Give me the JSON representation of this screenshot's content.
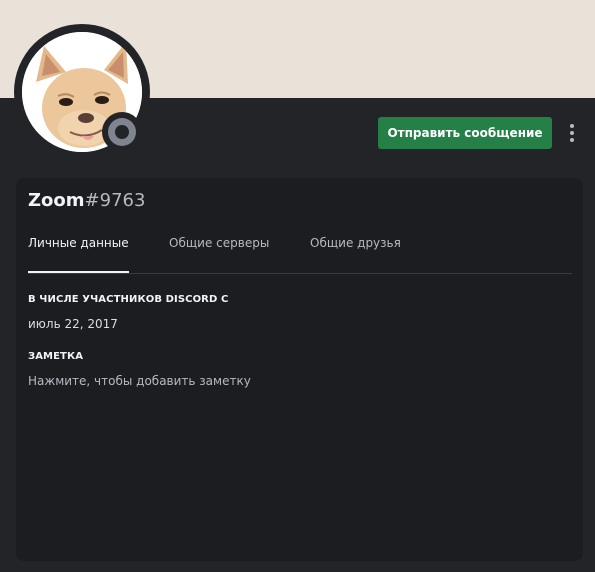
{
  "profile": {
    "username": "Zoom",
    "discriminator": "#9763",
    "status": "offline",
    "avatar_icon": "chihuahua-avatar"
  },
  "actions": {
    "send_message_label": "Отправить сообщение",
    "more_icon": "more-vertical-icon"
  },
  "tabs": [
    {
      "label": "Личные данные",
      "active": true
    },
    {
      "label": "Общие серверы",
      "active": false
    },
    {
      "label": "Общие друзья",
      "active": false
    }
  ],
  "member_since": {
    "title": "В ЧИСЛЕ УЧАСТНИКОВ DISCORD С",
    "date": "июль 22, 2017"
  },
  "note": {
    "title": "ЗАМЕТКА",
    "placeholder": "Нажмите, чтобы добавить заметку"
  },
  "colors": {
    "banner": "#eae1d8",
    "background": "#232428",
    "panel": "#1c1d21",
    "button": "#248046",
    "status_offline": "#80848e"
  }
}
